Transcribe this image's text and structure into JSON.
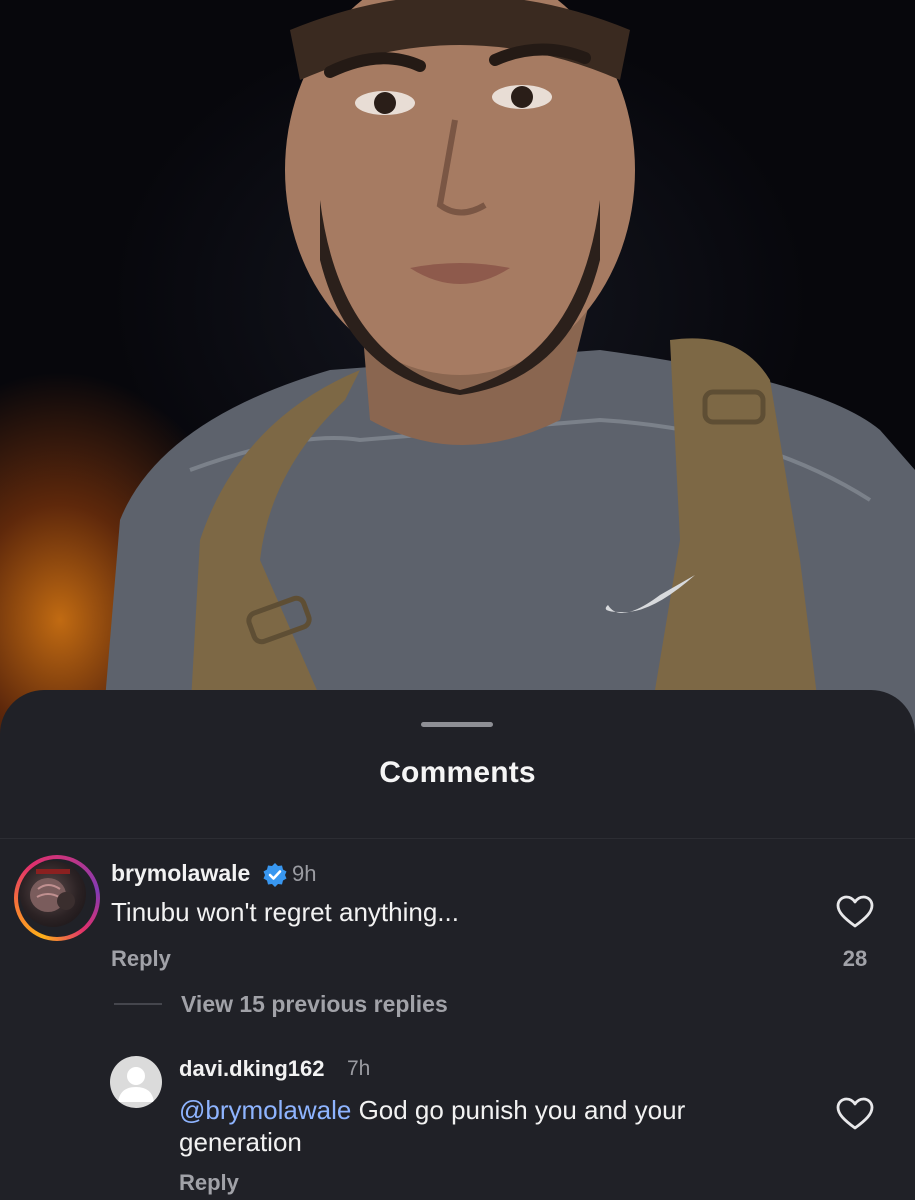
{
  "sheet": {
    "title": "Comments"
  },
  "comments": [
    {
      "username": "brymolawale",
      "verified": true,
      "time": "9h",
      "text": "Tinubu won't regret anything...",
      "reply_label": "Reply",
      "likes": "28",
      "view_replies": "View 15 previous replies"
    }
  ],
  "replies": [
    {
      "username": "davi.dking162",
      "time": "7h",
      "mention": "@brymolawale",
      "text_line1": " God go punish you and your",
      "text_line2": "generation",
      "reply_label": "Reply"
    }
  ],
  "colors": {
    "sheet_background": "#202127",
    "mention": "#8eb4ff",
    "verified_badge": "#3897f0",
    "secondary_text": "#a1a2a8"
  },
  "icons": {
    "like": "heart-icon",
    "verified": "verified-badge-icon",
    "default_avatar": "person-silhouette-icon"
  }
}
